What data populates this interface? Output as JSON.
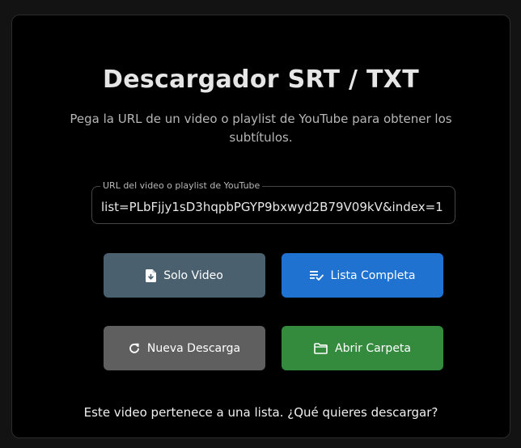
{
  "header": {
    "title": "Descargador SRT / TXT",
    "subtitle": "Pega la URL de un video o playlist de YouTube para obtener los subtítulos."
  },
  "url_field": {
    "label": "URL del video o playlist de YouTube",
    "value": "list=PLbFjjy1sD3hqpbPGYP9bxwyd2B79V09kV&index=1"
  },
  "buttons": {
    "solo_video": {
      "label": "Solo Video",
      "icon": "file-download-icon"
    },
    "lista_completa": {
      "label": "Lista Completa",
      "icon": "playlist-check-icon"
    },
    "nueva_descarga": {
      "label": "Nueva Descarga",
      "icon": "refresh-icon"
    },
    "abrir_carpeta": {
      "label": "Abrir Carpeta",
      "icon": "folder-icon"
    }
  },
  "status": {
    "message": "Este video pertenece a una lista. ¿Qué quieres descargar?"
  },
  "colors": {
    "background": "#000000",
    "solo_video": "#4b606e",
    "lista_completa": "#1f72cf",
    "nueva_descarga": "#5f5f5f",
    "abrir_carpeta": "#348b3e"
  }
}
